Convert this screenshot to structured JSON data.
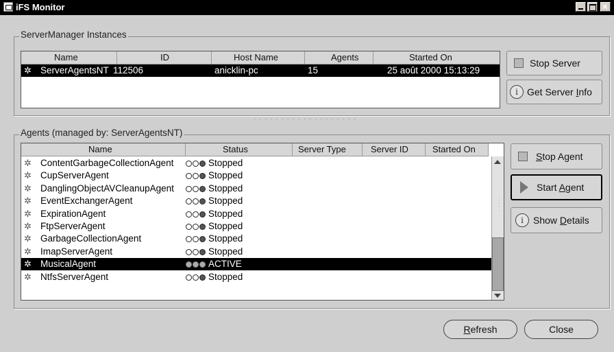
{
  "window": {
    "title": "iFS Monitor",
    "close_glyph": "×"
  },
  "server_panel": {
    "legend": "ServerManager Instances",
    "columns": [
      "Name",
      "ID",
      "Host Name",
      "Agents",
      "Started On"
    ],
    "rows": [
      {
        "name": "ServerAgentsNT",
        "id": "112506",
        "host": "anicklin-pc",
        "agents": "15",
        "started": "25 août 2000 15:13:29",
        "icon": "gear-icon"
      }
    ],
    "buttons": {
      "stop": "Stop Server",
      "info_pre": "Get Server ",
      "info_u": "I",
      "info_post": "nfo"
    }
  },
  "agents_panel": {
    "legend": "Agents (managed by: ServerAgentsNT)",
    "columns": [
      "Name",
      "Status",
      "Server Type",
      "Server ID",
      "Started On"
    ],
    "rows": [
      {
        "name": "ContentGarbageCollectionAgent",
        "status": "Stopped",
        "selected": false
      },
      {
        "name": "CupServerAgent",
        "status": "Stopped",
        "selected": false
      },
      {
        "name": "DanglingObjectAVCleanupAgent",
        "status": "Stopped",
        "selected": false
      },
      {
        "name": "EventExchangerAgent",
        "status": "Stopped",
        "selected": false
      },
      {
        "name": "ExpirationAgent",
        "status": "Stopped",
        "selected": false
      },
      {
        "name": "FtpServerAgent",
        "status": "Stopped",
        "selected": false
      },
      {
        "name": "GarbageCollectionAgent",
        "status": "Stopped",
        "selected": false
      },
      {
        "name": "ImapServerAgent",
        "status": "Stopped",
        "selected": false
      },
      {
        "name": "MusicalAgent",
        "status": "ACTIVE",
        "selected": true
      },
      {
        "name": "NtfsServerAgent",
        "status": "Stopped",
        "selected": false
      }
    ],
    "buttons": {
      "stop_u": "S",
      "stop_rest": "top Agent",
      "start_pre": "Start ",
      "start_u": "A",
      "start_post": "gent",
      "details_pre": "Show ",
      "details_u": "D",
      "details_post": "etails"
    }
  },
  "footer": {
    "refresh_u": "R",
    "refresh_rest": "efresh",
    "close": "Close"
  },
  "icons": {
    "window": "app-icon",
    "row": "gear-icon",
    "info": "info-icon",
    "play": "play-icon",
    "stop": "stop-square-icon"
  }
}
